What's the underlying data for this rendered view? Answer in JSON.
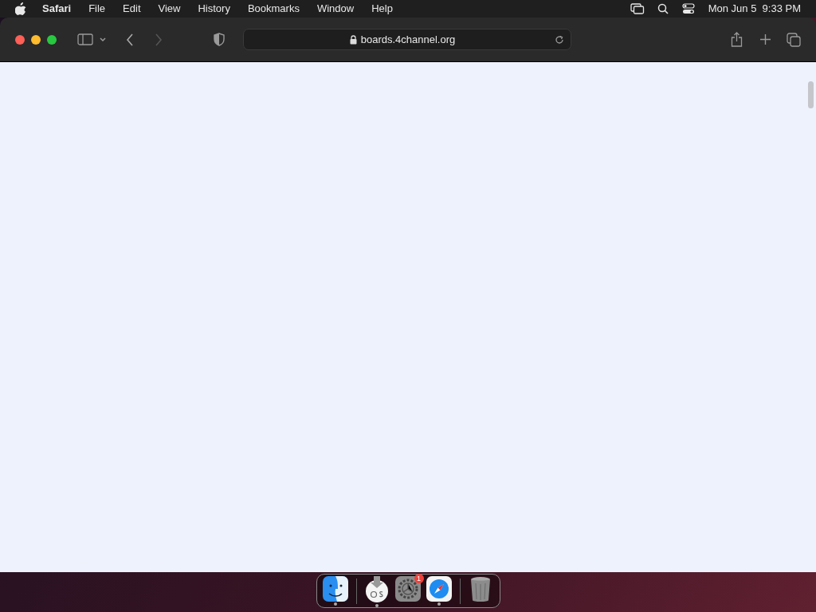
{
  "menu_bar": {
    "app_menu": "Safari",
    "items": [
      "File",
      "Edit",
      "View",
      "History",
      "Bookmarks",
      "Window",
      "Help"
    ],
    "clock": "Mon Jun 5  9:33 PM"
  },
  "browser": {
    "address": "boards.4channel.org",
    "back_enabled": true,
    "forward_enabled": false
  },
  "dock": {
    "apps": [
      {
        "kind": "finder",
        "running": true
      },
      {
        "kind": "installer",
        "running": true
      },
      {
        "kind": "settings",
        "running": false,
        "badge": "1"
      },
      {
        "kind": "safari",
        "running": true
      },
      {
        "kind": "trash",
        "running": false
      }
    ]
  }
}
